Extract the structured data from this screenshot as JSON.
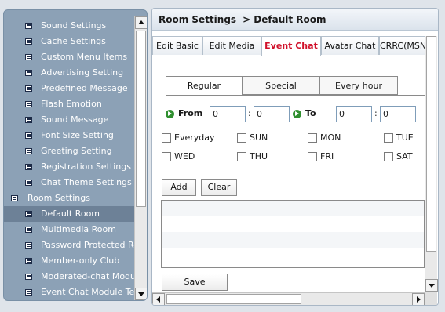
{
  "sidebar": {
    "items": [
      {
        "label": "Sound Settings",
        "level": "child"
      },
      {
        "label": "Cache Settings",
        "level": "child"
      },
      {
        "label": "Custom Menu Items",
        "level": "child"
      },
      {
        "label": "Advertising Setting",
        "level": "child"
      },
      {
        "label": "Predefined Message",
        "level": "child"
      },
      {
        "label": "Flash Emotion",
        "level": "child"
      },
      {
        "label": "Sound Message",
        "level": "child"
      },
      {
        "label": "Font Size Setting",
        "level": "child"
      },
      {
        "label": "Greeting Setting",
        "level": "child"
      },
      {
        "label": "Registration Settings",
        "level": "child"
      },
      {
        "label": "Chat Theme Settings",
        "level": "child"
      },
      {
        "label": "Room Settings",
        "level": "parent"
      },
      {
        "label": "Default Room",
        "level": "child",
        "selected": true
      },
      {
        "label": "Multimedia Room",
        "level": "child"
      },
      {
        "label": "Password Protected Roc",
        "level": "child"
      },
      {
        "label": "Member-only Club",
        "level": "child"
      },
      {
        "label": "Moderated-chat Module",
        "level": "child"
      },
      {
        "label": "Event Chat Module Test",
        "level": "child"
      }
    ]
  },
  "header": {
    "section": "Room Settings",
    "page": "> Default Room"
  },
  "tabs": [
    {
      "label": "Edit Basic"
    },
    {
      "label": "Edit Media"
    },
    {
      "label": "Event Chat",
      "active": true
    },
    {
      "label": "Avatar Chat"
    },
    {
      "label": "CRRC(MSN"
    }
  ],
  "subtabs": [
    {
      "label": "Regular",
      "active": true
    },
    {
      "label": "Special"
    },
    {
      "label": "Every hour"
    }
  ],
  "time": {
    "from_label": "From",
    "to_label": "To",
    "from_hour": "0",
    "from_minute": "0",
    "to_hour": "0",
    "to_minute": "0",
    "separator": ":"
  },
  "days": [
    {
      "label": "Everyday",
      "checked": false
    },
    {
      "label": "SUN",
      "checked": false
    },
    {
      "label": "MON",
      "checked": false
    },
    {
      "label": "TUE",
      "checked": false
    },
    {
      "label": "WED",
      "checked": false
    },
    {
      "label": "THU",
      "checked": false
    },
    {
      "label": "FRI",
      "checked": false
    },
    {
      "label": "SAT",
      "checked": false
    }
  ],
  "buttons": {
    "add": "Add",
    "clear": "Clear",
    "save": "Save"
  },
  "colors": {
    "sidebar_bg": "#8ca1b6",
    "selected_bg": "#6d8197",
    "active_tab_text": "#d0102a",
    "go_icon": "#2f8f2f"
  }
}
